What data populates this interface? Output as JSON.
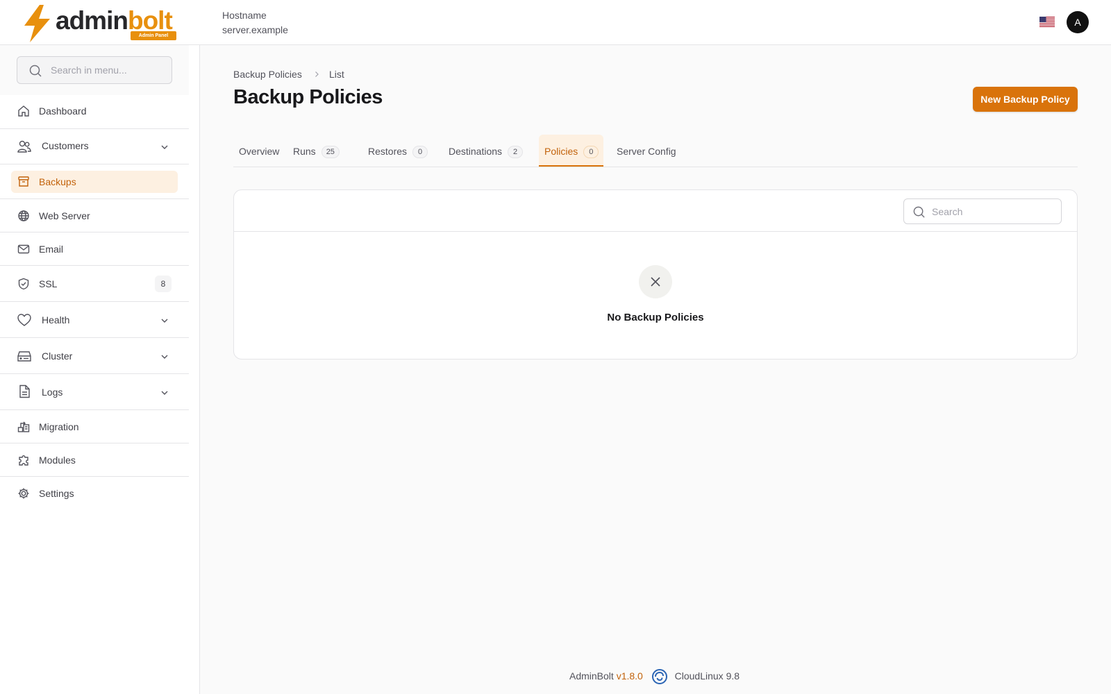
{
  "brand": {
    "name_part1": "admin",
    "name_part2": "bolt",
    "tag": "Admin Panel",
    "accent_color": "#e8900e"
  },
  "header": {
    "host_label": "Hostname",
    "host_value": "server.example",
    "avatar_initial": "A",
    "flag_icon": "us-flag-icon"
  },
  "sidebar": {
    "search_placeholder": "Search in menu...",
    "items": [
      {
        "label": "Dashboard",
        "icon": "home-icon"
      },
      {
        "label": "Customers",
        "icon": "users-icon",
        "expandable": true
      },
      {
        "label": "Backups",
        "icon": "archive-icon",
        "active": true
      },
      {
        "label": "Web Server",
        "icon": "globe-icon"
      },
      {
        "label": "Email",
        "icon": "mail-icon"
      },
      {
        "label": "SSL",
        "icon": "shield-icon",
        "badge": "8"
      },
      {
        "label": "Health",
        "icon": "heart-icon",
        "expandable": true
      },
      {
        "label": "Cluster",
        "icon": "server-icon",
        "expandable": true
      },
      {
        "label": "Logs",
        "icon": "file-icon",
        "expandable": true
      },
      {
        "label": "Migration",
        "icon": "migration-icon"
      },
      {
        "label": "Modules",
        "icon": "puzzle-icon"
      },
      {
        "label": "Settings",
        "icon": "gear-icon"
      }
    ]
  },
  "breadcrumb": {
    "parent": "Backup Policies",
    "current": "List"
  },
  "page": {
    "title": "Backup Policies",
    "new_button": "New Backup Policy"
  },
  "tabs": [
    {
      "label": "Overview"
    },
    {
      "label": "Runs",
      "count": "25"
    },
    {
      "label": "Restores",
      "count": "0"
    },
    {
      "label": "Destinations",
      "count": "2"
    },
    {
      "label": "Policies",
      "count": "0",
      "active": true
    },
    {
      "label": "Server Config"
    }
  ],
  "table": {
    "search_placeholder": "Search",
    "empty_text": "No Backup Policies"
  },
  "footer": {
    "product": "AdminBolt",
    "version": "v1.8.0",
    "os": "CloudLinux 9.8"
  }
}
